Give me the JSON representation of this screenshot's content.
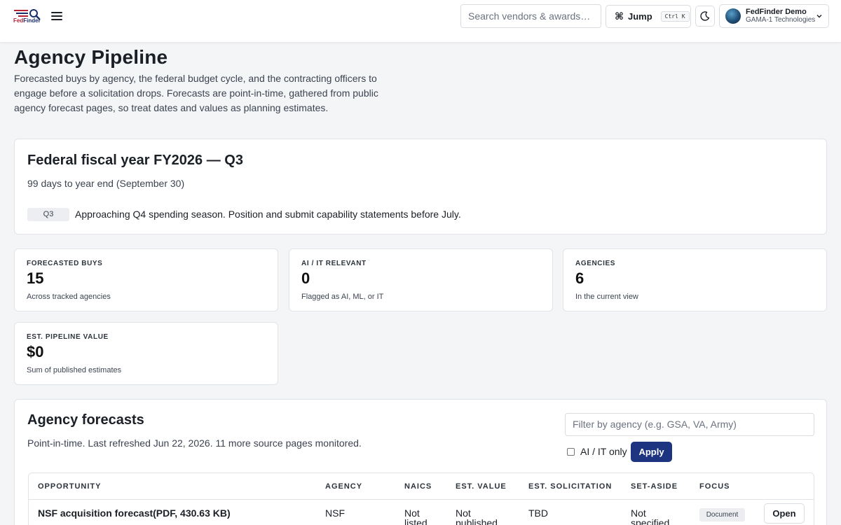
{
  "header": {
    "logo_text_a": "Fed",
    "logo_text_b": "Finder",
    "search_placeholder": "Search vendors & awards…",
    "jump_icon": "⌘",
    "jump_label": "Jump",
    "jump_shortcut": "Ctrl K",
    "user_name": "FedFinder Demo",
    "user_org": "GAMA-1 Technologies"
  },
  "intro": {
    "title": "Agency Pipeline",
    "description": "Forecasted buys by agency, the federal budget cycle, and the contracting officers to engage before a solicitation drops. Forecasts are point-in-time, gathered from public agency forecast pages, so treat dates and values as planning estimates."
  },
  "fiscal": {
    "title": "Federal fiscal year FY2026 — Q3",
    "subtitle": "99 days to year end (September 30)",
    "quarter": "Q3",
    "message": "Approaching Q4 spending season. Position and submit capability statements before July."
  },
  "stats": [
    {
      "label": "FORECASTED BUYS",
      "value": "15",
      "sub": "Across tracked agencies"
    },
    {
      "label": "AI / IT RELEVANT",
      "value": "0",
      "sub": "Flagged as AI, ML, or IT"
    },
    {
      "label": "AGENCIES",
      "value": "6",
      "sub": "In the current view"
    },
    {
      "label": "EST. PIPELINE VALUE",
      "value": "$0",
      "sub": "Sum of published estimates"
    }
  ],
  "forecasts": {
    "title": "Agency forecasts",
    "subtitle": "Point-in-time. Last refreshed Jun 22, 2026. 11 more source pages monitored.",
    "filter_placeholder": "Filter by agency (e.g. GSA, VA, Army)",
    "checkbox_label": "AI / IT only",
    "apply_label": "Apply",
    "columns": [
      "OPPORTUNITY",
      "AGENCY",
      "NAICS",
      "EST. VALUE",
      "EST. SOLICITATION",
      "SET-ASIDE",
      "FOCUS"
    ],
    "rows": [
      {
        "opportunity": "NSF acquisition forecast(PDF, 430.63 KB)",
        "agency": "NSF",
        "naics_a": "Not",
        "naics_b": "listed",
        "value_a": "Not",
        "value_b": "published",
        "solicitation": "TBD",
        "setaside_a": "Not",
        "setaside_b": "specified",
        "focus": "Document",
        "action": "Open"
      }
    ]
  }
}
